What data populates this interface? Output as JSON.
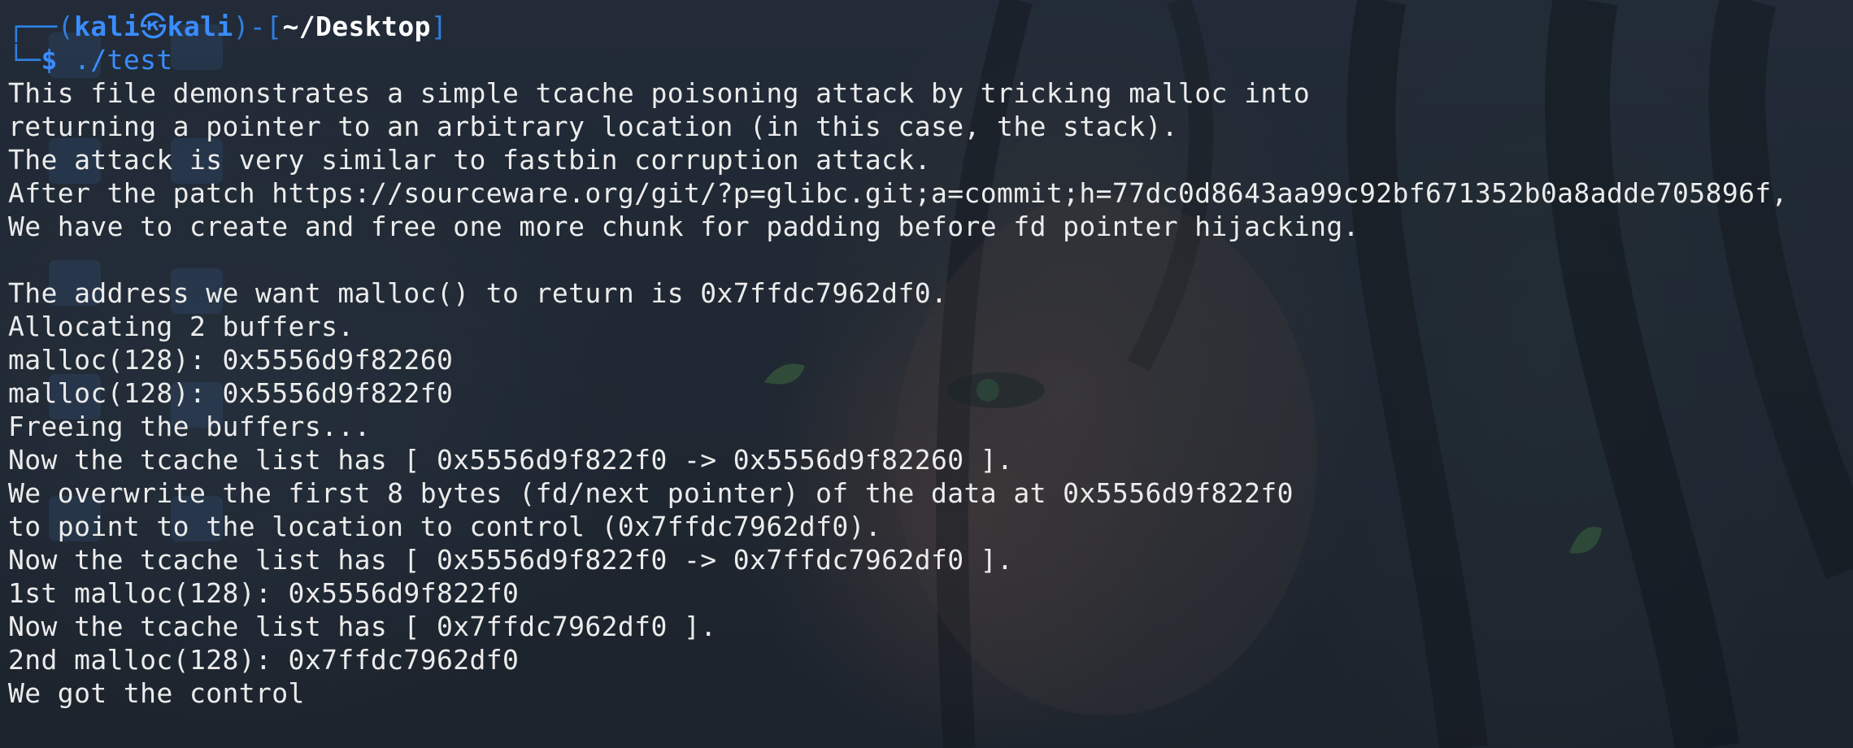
{
  "prompt": {
    "frame_open": "┌──(",
    "user": "kali",
    "at_symbol": "㉿",
    "host": "kali",
    "frame_mid": ")-[",
    "path": "~/Desktop",
    "frame_close": "]",
    "second_prefix": "└─",
    "dollar": "$",
    "command": " ./test"
  },
  "output_lines": [
    "This file demonstrates a simple tcache poisoning attack by tricking malloc into",
    "returning a pointer to an arbitrary location (in this case, the stack).",
    "The attack is very similar to fastbin corruption attack.",
    "After the patch https://sourceware.org/git/?p=glibc.git;a=commit;h=77dc0d8643aa99c92bf671352b0a8adde705896f,",
    "We have to create and free one more chunk for padding before fd pointer hijacking.",
    "",
    "The address we want malloc() to return is 0x7ffdc7962df0.",
    "Allocating 2 buffers.",
    "malloc(128): 0x5556d9f82260",
    "malloc(128): 0x5556d9f822f0",
    "Freeing the buffers...",
    "Now the tcache list has [ 0x5556d9f822f0 -> 0x5556d9f82260 ].",
    "We overwrite the first 8 bytes (fd/next pointer) of the data at 0x5556d9f822f0",
    "to point to the location to control (0x7ffdc7962df0).",
    "Now the tcache list has [ 0x5556d9f822f0 -> 0x7ffdc7962df0 ].",
    "1st malloc(128): 0x5556d9f822f0",
    "Now the tcache list has [ 0x7ffdc7962df0 ].",
    "2nd malloc(128): 0x7ffdc7962df0",
    "We got the control"
  ],
  "colors": {
    "prompt_accent": "#3a8cff",
    "text": "#ececec",
    "background": "#1f2a35"
  }
}
